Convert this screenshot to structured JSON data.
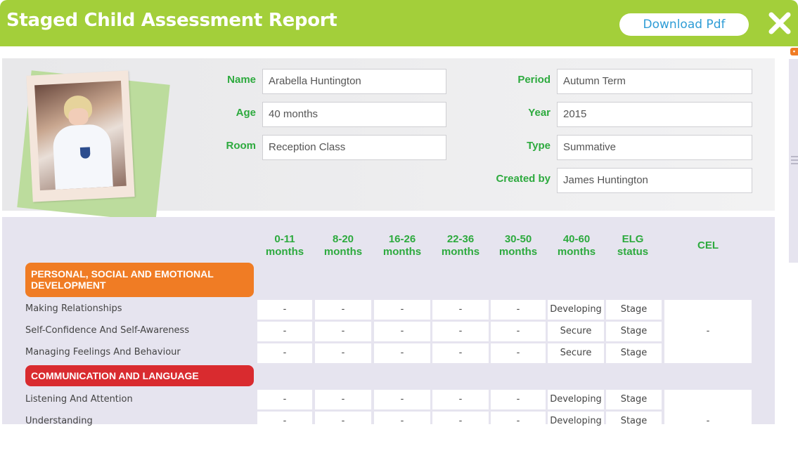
{
  "header": {
    "title": "Staged Child Assessment Report",
    "download_label": "Download Pdf",
    "close_icon": "close-icon"
  },
  "child": {
    "photo_icon": "child-photo",
    "fields": {
      "name": {
        "label": "Name",
        "value": "Arabella Huntington"
      },
      "age": {
        "label": "Age",
        "value": "40 months"
      },
      "room": {
        "label": "Room",
        "value": "Reception Class"
      },
      "period": {
        "label": "Period",
        "value": "Autumn Term"
      },
      "year": {
        "label": "Year",
        "value": "2015"
      },
      "type": {
        "label": "Type",
        "value": "Summative"
      },
      "created_by": {
        "label": "Created by",
        "value": "James Huntington"
      }
    }
  },
  "table": {
    "columns": [
      {
        "top": "0-11",
        "bottom": "months"
      },
      {
        "top": "8-20",
        "bottom": "months"
      },
      {
        "top": "16-26",
        "bottom": "months"
      },
      {
        "top": "22-36",
        "bottom": "months"
      },
      {
        "top": "30-50",
        "bottom": "months"
      },
      {
        "top": "40-60",
        "bottom": "months"
      },
      {
        "top": "ELG",
        "bottom": "status"
      },
      {
        "top": "CEL",
        "bottom": ""
      }
    ],
    "sections": [
      {
        "title_line1": "PERSONAL, SOCIAL AND EMOTIONAL",
        "title_line2": "DEVELOPMENT",
        "color": "#f07c24",
        "cel": "-",
        "rows": [
          {
            "label": "Making Relationships",
            "cells": [
              "-",
              "-",
              "-",
              "-",
              "-",
              "Developing",
              "Stage"
            ]
          },
          {
            "label": "Self-Confidence And Self-Awareness",
            "cells": [
              "-",
              "-",
              "-",
              "-",
              "-",
              "Secure",
              "Stage"
            ]
          },
          {
            "label": "Managing Feelings And Behaviour",
            "cells": [
              "-",
              "-",
              "-",
              "-",
              "-",
              "Secure",
              "Stage"
            ]
          }
        ]
      },
      {
        "title_line1": "COMMUNICATION AND LANGUAGE",
        "title_line2": "",
        "color": "#d92b2f",
        "cel": "-",
        "rows": [
          {
            "label": "Listening And Attention",
            "cells": [
              "-",
              "-",
              "-",
              "-",
              "-",
              "Developing",
              "Stage"
            ]
          },
          {
            "label": "Understanding",
            "cells": [
              "-",
              "-",
              "-",
              "-",
              "-",
              "Developing",
              "Stage"
            ]
          }
        ]
      }
    ]
  },
  "colors": {
    "header_bg": "#a3cf3a",
    "label_green": "#2daa3e",
    "download_text": "#2f9dd6",
    "table_bg": "#e6e4ef"
  }
}
